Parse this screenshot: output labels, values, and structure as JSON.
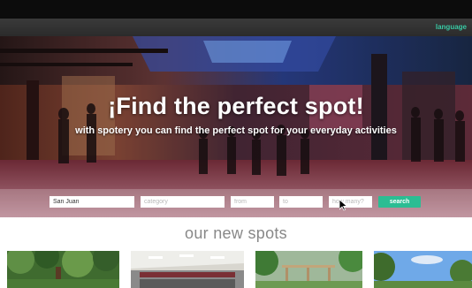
{
  "nav": {
    "language_label": "language"
  },
  "hero": {
    "title": "¡Find the perfect spot!",
    "subtitle": "with spotery you can find the perfect spot for your everyday activities"
  },
  "search": {
    "location_value": "San Juan",
    "category_placeholder": "category",
    "from_placeholder": "from",
    "to_placeholder": "to",
    "how_many_placeholder": "how many?",
    "button_label": "search"
  },
  "spots": {
    "section_title": "our new spots",
    "cards": [
      "garden-photo",
      "conference-room-photo",
      "park-pergola-photo",
      "sky-trees-photo"
    ]
  },
  "colors": {
    "accent": "#2bbd93",
    "language_link": "#39c9a4",
    "nav_bg": "#2f2f2f"
  }
}
